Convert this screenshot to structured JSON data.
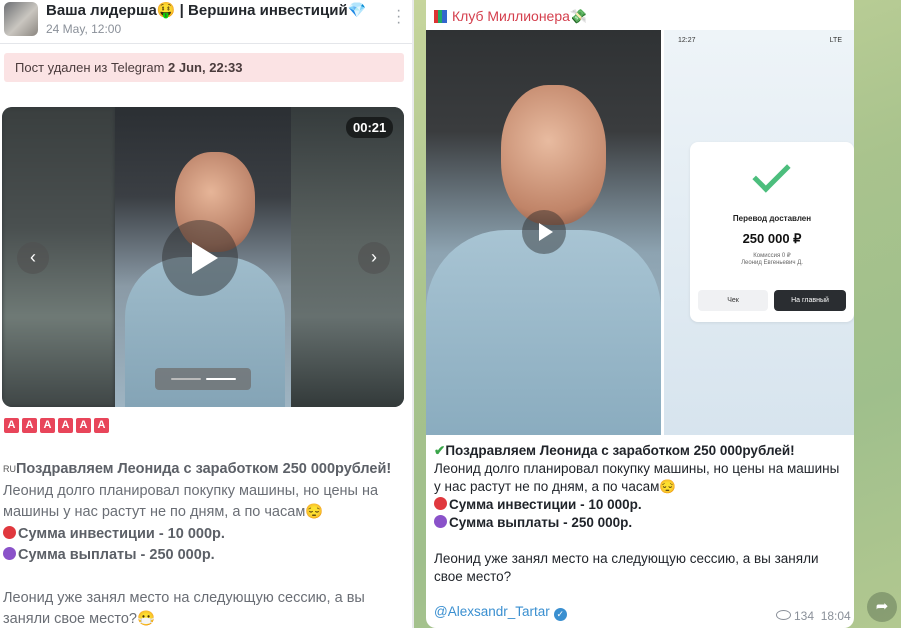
{
  "left_post": {
    "channel_name": "Ваша лидерша🤑 | Вершина инвестиций💎",
    "date": "24 May, 12:00",
    "deleted_prefix": "Пост удален из Telegram ",
    "deleted_date": "2 Jun, 22:33",
    "video_duration": "00:21",
    "badges": [
      "A",
      "A",
      "A",
      "A",
      "A",
      "A"
    ],
    "flag": "RU",
    "headline": "Поздравляем Леонида с заработком 250 000рублей!",
    "body": "Леонид долго планировал покупку машины, но цены на машины у нас растут не по дням, а по часам😔",
    "investment_line": "Сумма инвестиции - 10 000р.",
    "payout_line": "Сумма выплаты - 250 000р.",
    "closing": "Леонид уже занял место на следующую сессию, а вы заняли свое место?😷"
  },
  "right_post": {
    "channel_name": "Клуб Миллионера💸",
    "phone": {
      "time": "12:27",
      "status_right": "LTE",
      "title": "Перевод доставлен",
      "amount": "250 000 ₽",
      "fee": "Комиссия 0 ₽",
      "recipient": "Леонид Евгеньевич Д.",
      "btn_check": "Чек",
      "btn_main": "На главный"
    },
    "headline": "Поздравляем Леонида с заработком 250 000рублей!",
    "body": "Леонид долго планировал покупку машины, но цены на машины у нас растут не по дням, а по часам😔",
    "investment_line": "Сумма инвестиции - 10 000р.",
    "payout_line": "Сумма выплаты - 250 000р.",
    "closing": "Леонид уже занял место на следующую сессию, а вы заняли свое место?",
    "author": "@Alexsandr_Tartar",
    "views": "134",
    "time": "18:04"
  },
  "colors": {
    "deleted_bg": "#fbe3e4",
    "channel_red": "#d43f4d",
    "link_blue": "#3a8fd0",
    "badge_red": "#e8455a",
    "red_dot": "#e0383e",
    "purple_dot": "#8a52c9"
  }
}
